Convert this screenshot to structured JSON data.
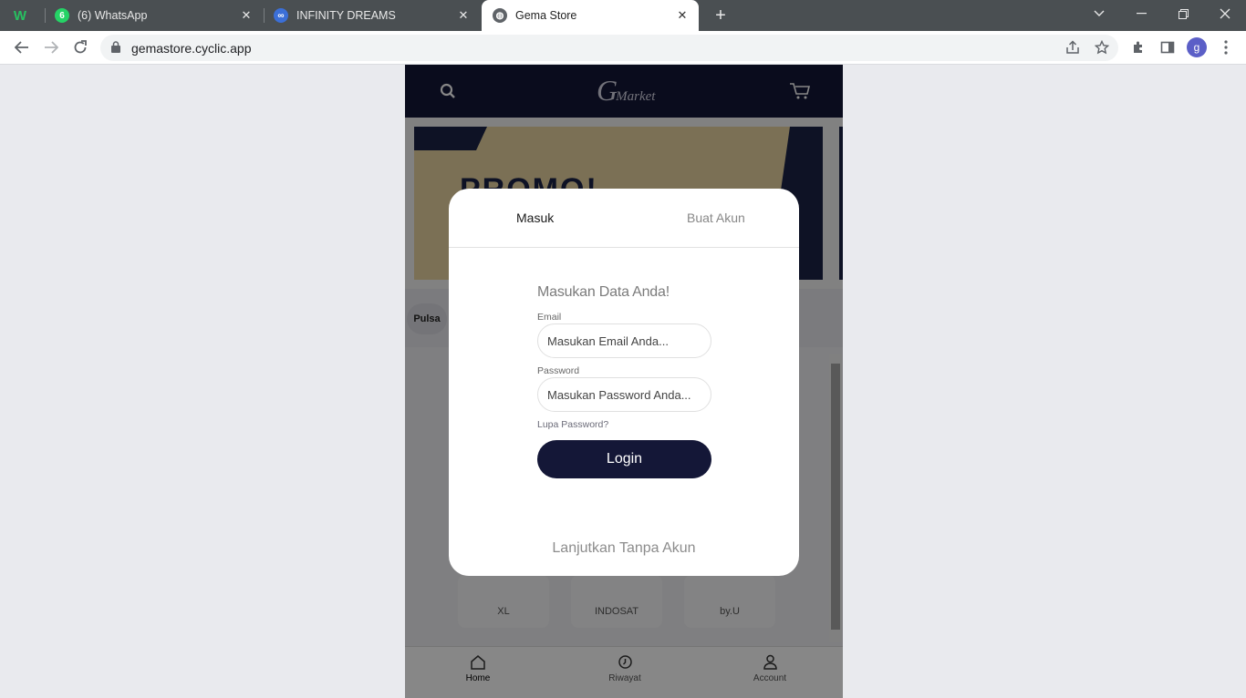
{
  "browser": {
    "tabs": [
      {
        "title": "(6) WhatsApp",
        "badge": "6",
        "active": false
      },
      {
        "title": "INFINITY DREAMS",
        "active": false
      },
      {
        "title": "Gema Store",
        "active": true
      }
    ],
    "url": "gemastore.cyclic.app",
    "profile_initial": "g",
    "new_tab": "+"
  },
  "app": {
    "logo_letter": "G",
    "logo_word": "Market",
    "banner_text": "PROMO!",
    "category_pill": "Pulsa",
    "operators": [
      "XL",
      "INDOSAT",
      "by.U"
    ],
    "bottom_nav": [
      {
        "label": "Home",
        "icon": "home-icon",
        "active": true
      },
      {
        "label": "Riwayat",
        "icon": "history-icon",
        "active": false
      },
      {
        "label": "Account",
        "icon": "account-icon",
        "active": false
      }
    ]
  },
  "modal": {
    "tab_login": "Masuk",
    "tab_register": "Buat Akun",
    "form_title": "Masukan Data Anda!",
    "email_label": "Email",
    "email_placeholder": "Masukan Email Anda...",
    "password_label": "Password",
    "password_placeholder": "Masukan Password Anda...",
    "forgot": "Lupa Password?",
    "login_button": "Login",
    "continue_guest": "Lanjutkan Tanpa Akun"
  },
  "colors": {
    "navy": "#141737",
    "tabstrip": "#4a4f52",
    "whatsapp": "#25d366"
  }
}
